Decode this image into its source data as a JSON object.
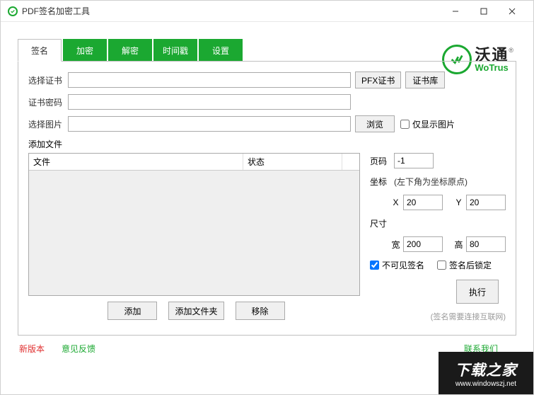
{
  "window": {
    "title": "PDF签名加密工具"
  },
  "logo": {
    "cn": "沃通",
    "en": "WoTrus"
  },
  "tabs": {
    "sign": "签名",
    "encrypt": "加密",
    "decrypt": "解密",
    "timestamp": "时间戳",
    "settings": "设置"
  },
  "form": {
    "certLabel": "选择证书",
    "pfxBtn": "PFX证书",
    "certStoreBtn": "证书库",
    "pwdLabel": "证书密码",
    "imgLabel": "选择图片",
    "browseBtn": "浏览",
    "onlyImageChk": "仅显示图片",
    "addFilesLabel": "添加文件",
    "colFile": "文件",
    "colStatus": "状态",
    "addBtn": "添加",
    "addFolderBtn": "添加文件夹",
    "removeBtn": "移除"
  },
  "side": {
    "pageLabel": "页码",
    "pageValue": "-1",
    "coordLabel": "坐标",
    "coordHint": "(左下角为坐标原点)",
    "xLabel": "X",
    "xValue": "20",
    "yLabel": "Y",
    "yValue": "20",
    "sizeLabel": "尺寸",
    "wLabel": "宽",
    "wValue": "200",
    "hLabel": "高",
    "hValue": "80",
    "invisibleChk": "不可见签名",
    "lockChk": "签名后锁定",
    "execBtn": "执行",
    "note": "(签名需要连接互联网)"
  },
  "footer": {
    "newVersion": "新版本",
    "feedback": "意见反馈",
    "contact": "联系我们"
  },
  "watermark": {
    "cn": "下载之家",
    "url": "www.windowszj.net"
  }
}
